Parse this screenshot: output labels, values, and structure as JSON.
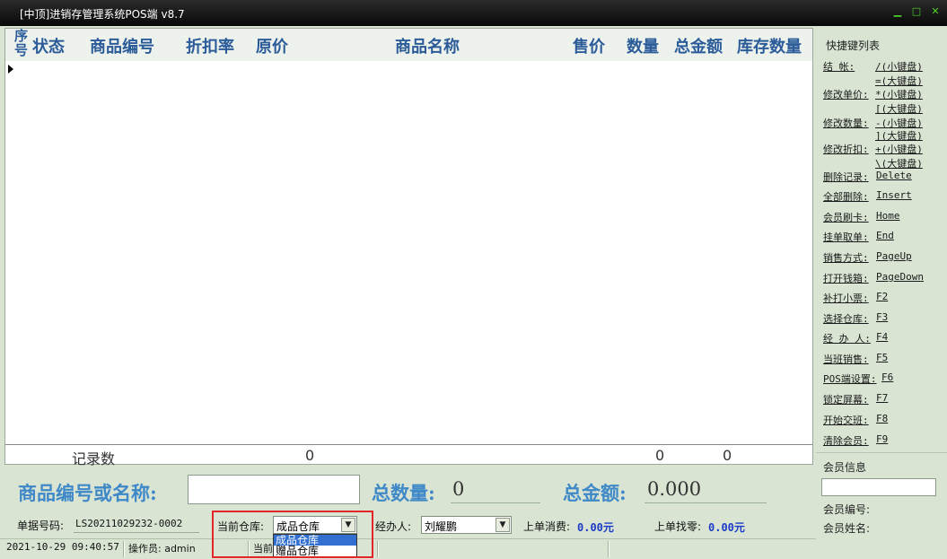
{
  "window": {
    "title": "[中顶]进销存管理系统POS端 v8.7",
    "controls": [
      "minimize",
      "maximize",
      "close"
    ]
  },
  "grid": {
    "seq_header": "序号",
    "columns": [
      "状态",
      "商品编号",
      "折扣率",
      "原价",
      "商品名称",
      "售价",
      "数量",
      "总金额",
      "库存数量"
    ],
    "footer": {
      "label": "记录数",
      "record_count": "0",
      "quantity_total": "0",
      "amount_total": "0"
    }
  },
  "entry": {
    "search_label": "商品编号或名称:",
    "search_value": "",
    "total_qty_label": "总数量:",
    "total_qty_value": "0",
    "total_amount_label": "总金额:",
    "total_amount_value": "0.000"
  },
  "info_row": {
    "doc_label": "单据号码:",
    "doc_value": "LS20211029232-0002",
    "warehouse_label": "当前仓库:",
    "warehouse_value": "成品仓库",
    "warehouse_options": [
      "成品仓库",
      "赠品仓库"
    ],
    "handler_label": "经办人:",
    "handler_value": "刘耀鹏",
    "last_spend_label": "上单消费:",
    "last_spend_value": "0.00元",
    "last_change_label": "上单找零:",
    "last_change_value": "0.00元"
  },
  "status_bar": {
    "datetime": "2021-10-29 09:40:57",
    "operator": "操作员: admin",
    "current_partial": "当前"
  },
  "sidebar": {
    "shortcut_title": "快捷键列表",
    "shortcuts": [
      {
        "label": "结    帐:",
        "keys": [
          "/(小键盘)",
          "=(大键盘)"
        ]
      },
      {
        "label": "修改单价:",
        "keys": [
          "*(小键盘)",
          "[(大键盘)"
        ]
      },
      {
        "label": "修改数量:",
        "keys": [
          "-(小键盘)",
          "](大键盘)"
        ]
      },
      {
        "label": "修改折扣:",
        "keys": [
          "+(小键盘)",
          "\\(大键盘)"
        ]
      },
      {
        "label": "删除记录:",
        "keys": [
          "Delete"
        ]
      },
      {
        "label": "全部删除:",
        "keys": [
          "Insert"
        ]
      },
      {
        "label": "会员刷卡:",
        "keys": [
          "Home"
        ]
      },
      {
        "label": "挂单取单:",
        "keys": [
          "End"
        ]
      },
      {
        "label": "销售方式:",
        "keys": [
          "PageUp"
        ]
      },
      {
        "label": "打开钱箱:",
        "keys": [
          "PageDown"
        ]
      },
      {
        "label": "补打小票:",
        "keys": [
          "F2"
        ]
      },
      {
        "label": "选择仓库:",
        "keys": [
          "F3"
        ]
      },
      {
        "label": "经 办 人:",
        "keys": [
          "F4"
        ]
      },
      {
        "label": "当班销售:",
        "keys": [
          "F5"
        ]
      },
      {
        "label": "POS端设置:",
        "keys": [
          "F6"
        ]
      },
      {
        "label": "锁定屏幕:",
        "keys": [
          "F7"
        ]
      },
      {
        "label": "开始交班:",
        "keys": [
          "F8"
        ]
      },
      {
        "label": "清除会员:",
        "keys": [
          "F9"
        ]
      }
    ],
    "member_title": "会员信息",
    "member_input": "",
    "member_no_label": "会员编号:",
    "member_name_label": "会员姓名:"
  }
}
